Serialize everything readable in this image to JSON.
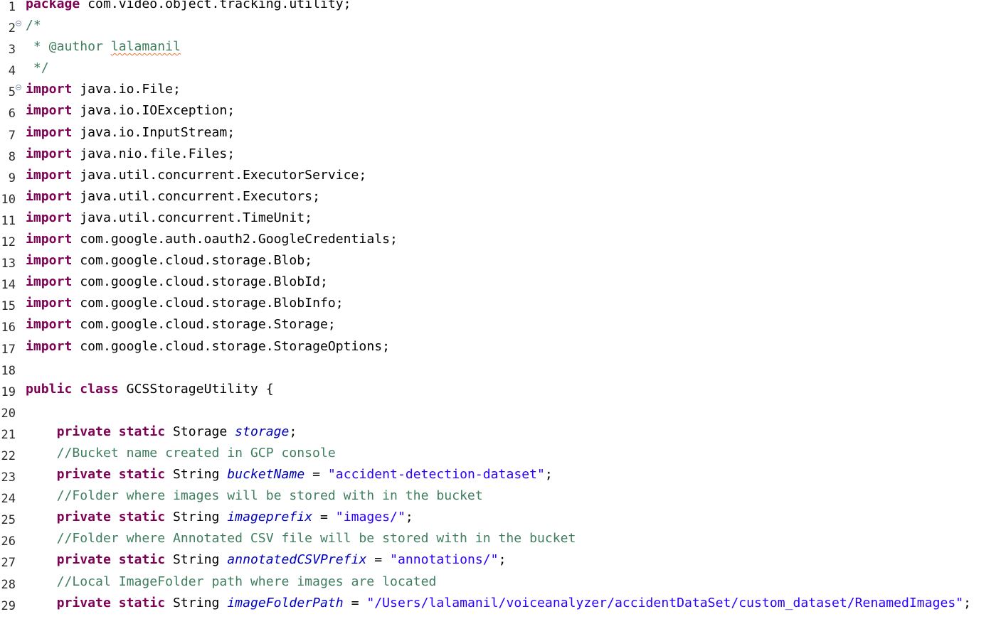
{
  "editor": {
    "lines": [
      {
        "n": "1",
        "fold": false,
        "tokens": [
          {
            "t": "kw",
            "v": "package"
          },
          {
            "t": "tx",
            "v": " com.video.object.tracking.utility;"
          }
        ]
      },
      {
        "n": "2",
        "fold": true,
        "tokens": [
          {
            "t": "cm",
            "v": "/*"
          }
        ]
      },
      {
        "n": "3",
        "fold": false,
        "tokens": [
          {
            "t": "cm",
            "v": " * @author "
          },
          {
            "t": "cmspell",
            "v": "lalamanil"
          }
        ]
      },
      {
        "n": "4",
        "fold": false,
        "tokens": [
          {
            "t": "cm",
            "v": " */"
          }
        ]
      },
      {
        "n": "5",
        "fold": true,
        "tokens": [
          {
            "t": "kw",
            "v": "import"
          },
          {
            "t": "tx",
            "v": " java.io.File;"
          }
        ]
      },
      {
        "n": "6",
        "fold": false,
        "tokens": [
          {
            "t": "kw",
            "v": "import"
          },
          {
            "t": "tx",
            "v": " java.io.IOException;"
          }
        ]
      },
      {
        "n": "7",
        "fold": false,
        "tokens": [
          {
            "t": "kw",
            "v": "import"
          },
          {
            "t": "tx",
            "v": " java.io.InputStream;"
          }
        ]
      },
      {
        "n": "8",
        "fold": false,
        "tokens": [
          {
            "t": "kw",
            "v": "import"
          },
          {
            "t": "tx",
            "v": " java.nio.file.Files;"
          }
        ]
      },
      {
        "n": "9",
        "fold": false,
        "tokens": [
          {
            "t": "kw",
            "v": "import"
          },
          {
            "t": "tx",
            "v": " java.util.concurrent.ExecutorService;"
          }
        ]
      },
      {
        "n": "10",
        "fold": false,
        "tokens": [
          {
            "t": "kw",
            "v": "import"
          },
          {
            "t": "tx",
            "v": " java.util.concurrent.Executors;"
          }
        ]
      },
      {
        "n": "11",
        "fold": false,
        "tokens": [
          {
            "t": "kw",
            "v": "import"
          },
          {
            "t": "tx",
            "v": " java.util.concurrent.TimeUnit;"
          }
        ]
      },
      {
        "n": "12",
        "fold": false,
        "tokens": [
          {
            "t": "kw",
            "v": "import"
          },
          {
            "t": "tx",
            "v": " com.google.auth.oauth2.GoogleCredentials;"
          }
        ]
      },
      {
        "n": "13",
        "fold": false,
        "tokens": [
          {
            "t": "kw",
            "v": "import"
          },
          {
            "t": "tx",
            "v": " com.google.cloud.storage.Blob;"
          }
        ]
      },
      {
        "n": "14",
        "fold": false,
        "tokens": [
          {
            "t": "kw",
            "v": "import"
          },
          {
            "t": "tx",
            "v": " com.google.cloud.storage.BlobId;"
          }
        ]
      },
      {
        "n": "15",
        "fold": false,
        "tokens": [
          {
            "t": "kw",
            "v": "import"
          },
          {
            "t": "tx",
            "v": " com.google.cloud.storage.BlobInfo;"
          }
        ]
      },
      {
        "n": "16",
        "fold": false,
        "tokens": [
          {
            "t": "kw",
            "v": "import"
          },
          {
            "t": "tx",
            "v": " com.google.cloud.storage.Storage;"
          }
        ]
      },
      {
        "n": "17",
        "fold": false,
        "tokens": [
          {
            "t": "kw",
            "v": "import"
          },
          {
            "t": "tx",
            "v": " com.google.cloud.storage.StorageOptions;"
          }
        ]
      },
      {
        "n": "18",
        "fold": false,
        "tokens": []
      },
      {
        "n": "19",
        "fold": false,
        "tokens": [
          {
            "t": "kw",
            "v": "public"
          },
          {
            "t": "tx",
            "v": " "
          },
          {
            "t": "kw",
            "v": "class"
          },
          {
            "t": "tx",
            "v": " GCSStorageUtility {"
          }
        ]
      },
      {
        "n": "20",
        "fold": false,
        "tokens": []
      },
      {
        "n": "21",
        "fold": false,
        "tokens": [
          {
            "t": "tx",
            "v": "    "
          },
          {
            "t": "kw",
            "v": "private"
          },
          {
            "t": "tx",
            "v": " "
          },
          {
            "t": "kw",
            "v": "static"
          },
          {
            "t": "tx",
            "v": " Storage "
          },
          {
            "t": "fd",
            "v": "storage"
          },
          {
            "t": "tx",
            "v": ";"
          }
        ]
      },
      {
        "n": "22",
        "fold": false,
        "tokens": [
          {
            "t": "tx",
            "v": "    "
          },
          {
            "t": "cm",
            "v": "//Bucket name created in GCP console"
          }
        ]
      },
      {
        "n": "23",
        "fold": false,
        "tokens": [
          {
            "t": "tx",
            "v": "    "
          },
          {
            "t": "kw",
            "v": "private"
          },
          {
            "t": "tx",
            "v": " "
          },
          {
            "t": "kw",
            "v": "static"
          },
          {
            "t": "tx",
            "v": " String "
          },
          {
            "t": "fd",
            "v": "bucketName"
          },
          {
            "t": "tx",
            "v": " = "
          },
          {
            "t": "st",
            "v": "\"accident-detection-dataset\""
          },
          {
            "t": "tx",
            "v": ";"
          }
        ]
      },
      {
        "n": "24",
        "fold": false,
        "tokens": [
          {
            "t": "tx",
            "v": "    "
          },
          {
            "t": "cm",
            "v": "//Folder where images will be stored with in the bucket"
          }
        ]
      },
      {
        "n": "25",
        "fold": false,
        "tokens": [
          {
            "t": "tx",
            "v": "    "
          },
          {
            "t": "kw",
            "v": "private"
          },
          {
            "t": "tx",
            "v": " "
          },
          {
            "t": "kw",
            "v": "static"
          },
          {
            "t": "tx",
            "v": " String "
          },
          {
            "t": "fd",
            "v": "imageprefix"
          },
          {
            "t": "tx",
            "v": " = "
          },
          {
            "t": "st",
            "v": "\"images/\""
          },
          {
            "t": "tx",
            "v": ";"
          }
        ]
      },
      {
        "n": "26",
        "fold": false,
        "tokens": [
          {
            "t": "tx",
            "v": "    "
          },
          {
            "t": "cm",
            "v": "//Folder where Annotated CSV file will be stored with in the bucket"
          }
        ]
      },
      {
        "n": "27",
        "fold": false,
        "tokens": [
          {
            "t": "tx",
            "v": "    "
          },
          {
            "t": "kw",
            "v": "private"
          },
          {
            "t": "tx",
            "v": " "
          },
          {
            "t": "kw",
            "v": "static"
          },
          {
            "t": "tx",
            "v": " String "
          },
          {
            "t": "fd",
            "v": "annotatedCSVPrefix"
          },
          {
            "t": "tx",
            "v": " = "
          },
          {
            "t": "st",
            "v": "\"annotations/\""
          },
          {
            "t": "tx",
            "v": ";"
          }
        ]
      },
      {
        "n": "28",
        "fold": false,
        "tokens": [
          {
            "t": "tx",
            "v": "    "
          },
          {
            "t": "cm",
            "v": "//Local ImageFolder path where images are located"
          }
        ]
      },
      {
        "n": "29",
        "fold": false,
        "tokens": [
          {
            "t": "tx",
            "v": "    "
          },
          {
            "t": "kw",
            "v": "private"
          },
          {
            "t": "tx",
            "v": " "
          },
          {
            "t": "kw",
            "v": "static"
          },
          {
            "t": "tx",
            "v": " String "
          },
          {
            "t": "fd",
            "v": "imageFolderPath"
          },
          {
            "t": "tx",
            "v": " = "
          },
          {
            "t": "st",
            "v": "\"/Users/lalamanil/voiceanalyzer/accidentDataSet/custom_dataset/RenamedImages\""
          },
          {
            "t": "tx",
            "v": ";"
          }
        ]
      }
    ]
  }
}
